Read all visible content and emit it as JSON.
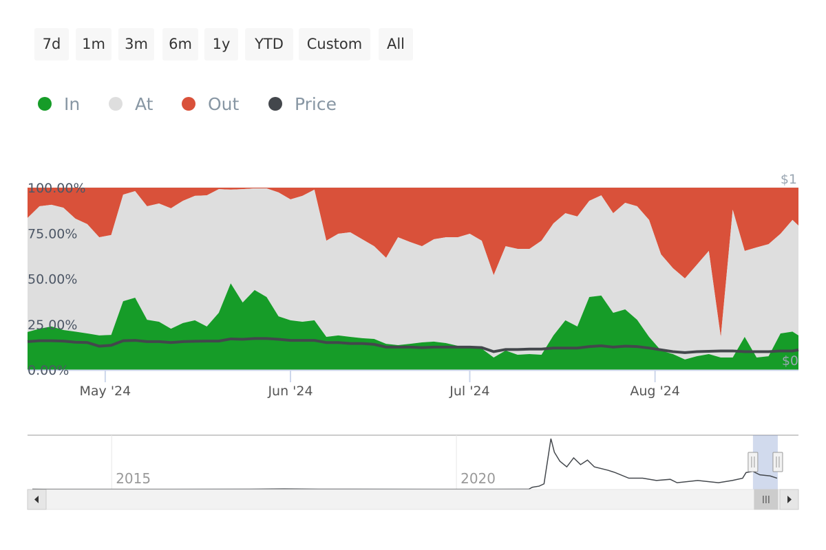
{
  "range_selector": {
    "buttons": [
      "7d",
      "1m",
      "3m",
      "6m",
      "1y",
      "YTD",
      "Custom",
      "All"
    ]
  },
  "legend": [
    {
      "label": "In",
      "color": "#169c28"
    },
    {
      "label": "At",
      "color": "#dedede"
    },
    {
      "label": "Out",
      "color": "#d9513a"
    },
    {
      "label": "Price",
      "color": "#43474c"
    }
  ],
  "chart_data": {
    "type": "area",
    "stacking": "percent",
    "x_range": [
      "2024-04-18",
      "2024-08-25"
    ],
    "x_ticks": [
      {
        "date": "2024-05-01",
        "label": "May '24"
      },
      {
        "date": "2024-06-01",
        "label": "Jun '24"
      },
      {
        "date": "2024-07-01",
        "label": "Jul '24"
      },
      {
        "date": "2024-08-01",
        "label": "Aug '24"
      }
    ],
    "y_left": {
      "ylim": [
        0,
        100
      ],
      "ticks": [
        "0.00%",
        "25.00%",
        "50.00%",
        "75.00%",
        "100.00%"
      ]
    },
    "y_right": {
      "ylim": [
        0,
        1
      ],
      "ticks": [
        "$0",
        "$1"
      ]
    },
    "grid": true,
    "legend_placement": "top-left",
    "x": [
      "2024-04-18",
      "2024-04-20",
      "2024-04-22",
      "2024-04-24",
      "2024-04-26",
      "2024-04-28",
      "2024-04-30",
      "2024-05-02",
      "2024-05-04",
      "2024-05-06",
      "2024-05-08",
      "2024-05-10",
      "2024-05-12",
      "2024-05-14",
      "2024-05-16",
      "2024-05-18",
      "2024-05-20",
      "2024-05-22",
      "2024-05-24",
      "2024-05-26",
      "2024-05-28",
      "2024-05-30",
      "2024-06-01",
      "2024-06-03",
      "2024-06-05",
      "2024-06-07",
      "2024-06-09",
      "2024-06-11",
      "2024-06-13",
      "2024-06-15",
      "2024-06-17",
      "2024-06-19",
      "2024-06-21",
      "2024-06-23",
      "2024-06-25",
      "2024-06-27",
      "2024-06-29",
      "2024-07-01",
      "2024-07-03",
      "2024-07-05",
      "2024-07-07",
      "2024-07-09",
      "2024-07-11",
      "2024-07-13",
      "2024-07-15",
      "2024-07-17",
      "2024-07-19",
      "2024-07-21",
      "2024-07-23",
      "2024-07-25",
      "2024-07-27",
      "2024-07-29",
      "2024-07-31",
      "2024-08-02",
      "2024-08-04",
      "2024-08-06",
      "2024-08-08",
      "2024-08-10",
      "2024-08-12",
      "2024-08-14",
      "2024-08-16",
      "2024-08-18",
      "2024-08-20",
      "2024-08-22",
      "2024-08-24",
      "2024-08-25"
    ],
    "series": [
      {
        "name": "In",
        "color": "#169c28",
        "values": [
          20.8,
          22.6,
          23.8,
          21.9,
          21,
          20,
          18.9,
          19.2,
          37.7,
          39.6,
          27.5,
          26.4,
          22.6,
          25.7,
          27.2,
          23.8,
          31.3,
          47.5,
          37,
          43.8,
          40,
          29.4,
          27.2,
          26.4,
          27.2,
          18.1,
          18.9,
          18.1,
          17.4,
          17,
          14.3,
          13.6,
          14.3,
          15.1,
          15.5,
          14.7,
          13.2,
          12.5,
          11.7,
          6.8,
          10.6,
          8.3,
          8.7,
          8.3,
          18.9,
          27.2,
          23.8,
          40,
          40.8,
          31.3,
          33.2,
          27.5,
          18.1,
          10.6,
          8.7,
          5.7,
          7.5,
          8.7,
          6.8,
          6.8,
          18.1,
          6.8,
          7.5,
          20,
          21,
          18.9
        ]
      },
      {
        "name": "At",
        "color": "#dedede",
        "values": [
          62.6,
          67.2,
          66.8,
          67.1,
          62,
          60,
          53.9,
          54.8,
          58.5,
          58.5,
          62.3,
          64.9,
          66.1,
          67.1,
          68.3,
          72,
          67.9,
          51.4,
          62.2,
          55.8,
          59.6,
          68,
          66.4,
          69.1,
          71.7,
          52.8,
          55.8,
          57.4,
          54.3,
          50.9,
          47.2,
          59.2,
          55.9,
          52.8,
          56.2,
          58.1,
          59.6,
          62.2,
          59.2,
          45.2,
          57.3,
          58.1,
          57.7,
          62.6,
          61.5,
          58.8,
          60.4,
          52.8,
          55,
          54.7,
          58.5,
          62.3,
          64.2,
          52.8,
          47.1,
          44.5,
          50.2,
          56.6,
          11.2,
          81.1,
          47.2,
          60.4,
          61.5,
          54.7,
          61.3,
          60.3
        ]
      },
      {
        "name": "Out",
        "color": "#d9513a",
        "values": [
          16.6,
          10.2,
          9.4,
          11,
          17,
          20,
          27.2,
          26,
          3.8,
          1.9,
          10.2,
          8.7,
          11.3,
          7.2,
          4.5,
          4.2,
          0.8,
          1.1,
          0.8,
          0.4,
          0.4,
          2.6,
          6.4,
          4.5,
          1.1,
          29.1,
          25.3,
          24.5,
          28.3,
          32.1,
          38.5,
          27.2,
          29.8,
          32.1,
          28.3,
          27.2,
          27.2,
          25.3,
          29.1,
          48,
          32.1,
          33.6,
          33.6,
          29.1,
          19.6,
          14,
          15.8,
          7.2,
          4.2,
          14,
          8.3,
          10.2,
          17.7,
          36.6,
          44.2,
          49.8,
          42.3,
          34.7,
          82,
          12.1,
          34.7,
          32.8,
          31,
          25.3,
          17.7,
          20.8
        ]
      },
      {
        "name": "Price",
        "color": "#43474c",
        "axis": "right",
        "values": [
          0.155,
          0.16,
          0.16,
          0.158,
          0.152,
          0.15,
          0.13,
          0.135,
          0.16,
          0.162,
          0.155,
          0.155,
          0.15,
          0.155,
          0.157,
          0.158,
          0.158,
          0.17,
          0.168,
          0.172,
          0.172,
          0.168,
          0.162,
          0.162,
          0.162,
          0.15,
          0.15,
          0.145,
          0.145,
          0.14,
          0.125,
          0.125,
          0.125,
          0.122,
          0.125,
          0.125,
          0.125,
          0.125,
          0.122,
          0.1,
          0.112,
          0.112,
          0.114,
          0.114,
          0.12,
          0.12,
          0.12,
          0.128,
          0.132,
          0.125,
          0.13,
          0.128,
          0.12,
          0.11,
          0.1,
          0.095,
          0.1,
          0.102,
          0.104,
          0.104,
          0.1,
          0.1,
          0.1,
          0.104,
          0.104,
          0.11
        ]
      }
    ],
    "navigator": {
      "x_ticks": [
        "2015",
        "2020"
      ],
      "x_range": [
        2013.78,
        2024.96
      ],
      "selected_range": [
        2024.3,
        2024.66
      ],
      "series": {
        "x": [
          2013.85,
          2014,
          2017,
          2017.5,
          2018,
          2020,
          2021.05,
          2021.1,
          2021.2,
          2021.27,
          2021.37,
          2021.42,
          2021.5,
          2021.6,
          2021.7,
          2021.8,
          2021.9,
          2022.0,
          2022.2,
          2022.3,
          2022.5,
          2022.7,
          2022.9,
          2023.1,
          2023.2,
          2023.5,
          2023.8,
          2024.0,
          2024.15,
          2024.2,
          2024.3,
          2024.4,
          2024.55,
          2024.65
        ],
        "values": [
          0.003,
          0.002,
          0.003,
          0.005,
          0.003,
          0.002,
          0.003,
          0.02,
          0.03,
          0.05,
          0.45,
          0.33,
          0.25,
          0.2,
          0.28,
          0.22,
          0.26,
          0.2,
          0.17,
          0.15,
          0.1,
          0.1,
          0.08,
          0.09,
          0.06,
          0.08,
          0.06,
          0.08,
          0.1,
          0.15,
          0.16,
          0.13,
          0.12,
          0.1
        ]
      }
    }
  }
}
